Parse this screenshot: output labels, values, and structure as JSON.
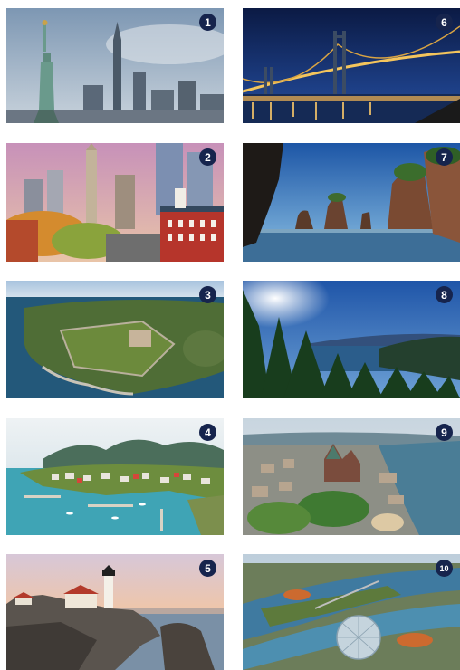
{
  "photos": [
    {
      "number": "1",
      "icon": "statue-of-liberty-skyline"
    },
    {
      "number": "2",
      "icon": "city-skyline-autumn"
    },
    {
      "number": "3",
      "icon": "coastal-fort-aerial"
    },
    {
      "number": "4",
      "icon": "harbor-town-mountains"
    },
    {
      "number": "5",
      "icon": "lighthouse-coast"
    },
    {
      "number": "6",
      "icon": "suspension-bridge-night"
    },
    {
      "number": "7",
      "icon": "sea-stack-rocks"
    },
    {
      "number": "8",
      "icon": "forest-fjord"
    },
    {
      "number": "9",
      "icon": "old-city-river-aerial"
    },
    {
      "number": "10",
      "icon": "biosphere-dome-river"
    }
  ]
}
